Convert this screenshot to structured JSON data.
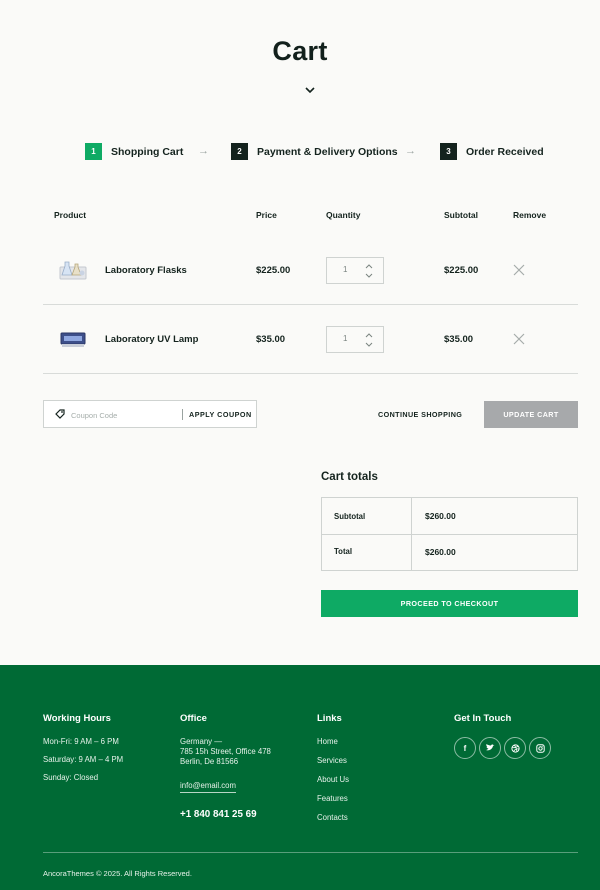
{
  "page": {
    "title": "Cart"
  },
  "steps": [
    {
      "num": "1",
      "label": "Shopping Cart"
    },
    {
      "num": "2",
      "label": "Payment & Delivery Options"
    },
    {
      "num": "3",
      "label": "Order Received"
    }
  ],
  "table": {
    "headers": {
      "product": "Product",
      "price": "Price",
      "quantity": "Quantity",
      "subtotal": "Subtotal",
      "remove": "Remove"
    },
    "items": [
      {
        "name": "Laboratory Flasks",
        "price": "$225.00",
        "qty": "1",
        "subtotal": "$225.00",
        "thumb_icon": "flasks-icon"
      },
      {
        "name": "Laboratory UV Lamp",
        "price": "$35.00",
        "qty": "1",
        "subtotal": "$35.00",
        "thumb_icon": "uv-lamp-icon"
      }
    ]
  },
  "coupon": {
    "placeholder": "Coupon Code",
    "button": "APPLY COUPON"
  },
  "actions": {
    "continue": "CONTINUE SHOPPING",
    "update": "UPDATE CART"
  },
  "totals": {
    "title": "Cart totals",
    "subtotal_label": "Subtotal",
    "subtotal_value": "$260.00",
    "total_label": "Total",
    "total_value": "$260.00",
    "checkout": "PROCEED TO CHECKOUT"
  },
  "footer": {
    "hours": {
      "title": "Working Hours",
      "lines": [
        "Mon-Fri: 9 AM – 6 PM",
        "Saturday: 9 AM – 4 PM",
        "Sunday: Closed"
      ]
    },
    "office": {
      "title": "Office",
      "lines": [
        "Germany —",
        "785 15h Street, Office 478",
        "Berlin, De 81566"
      ],
      "email": "info@email.com",
      "phone": "+1 840 841 25 69"
    },
    "links": {
      "title": "Links",
      "items": [
        "Home",
        "Services",
        "About Us",
        "Features",
        "Contacts"
      ]
    },
    "social": {
      "title": "Get In Touch",
      "icons": [
        "facebook-icon",
        "twitter-icon",
        "dribbble-icon",
        "instagram-icon"
      ]
    },
    "copyright": "AncoraThemes © 2025. All Rights Reserved."
  },
  "colors": {
    "accent": "#0eaa64",
    "footer_bg": "#006a35",
    "dark": "#14231e",
    "update_btn": "#a7a9ab"
  }
}
